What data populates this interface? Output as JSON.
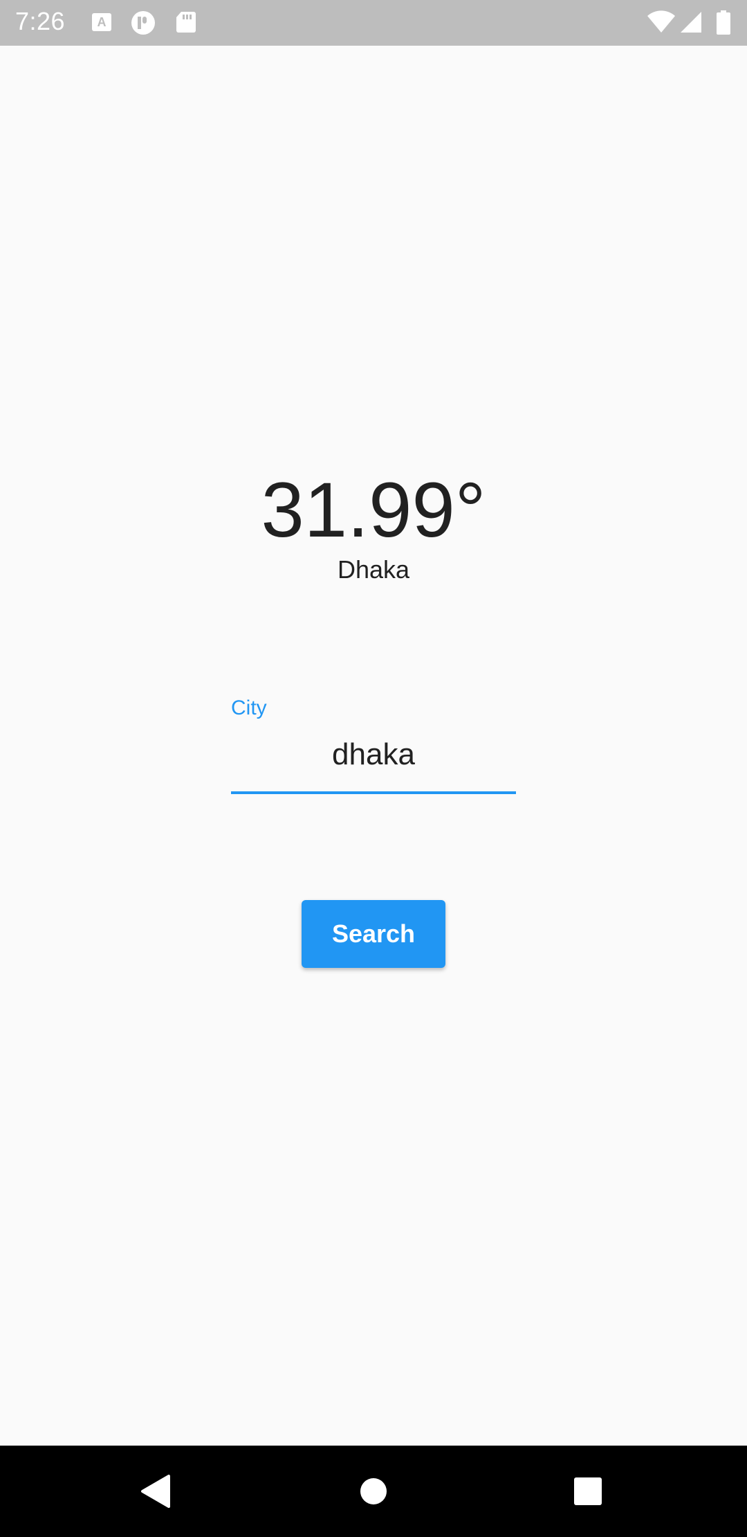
{
  "status_bar": {
    "time": "7:26",
    "left_icons": [
      "keyboard-a-icon",
      "circle-p-icon",
      "sd-card-icon"
    ],
    "right_icons": [
      "wifi-icon",
      "signal-icon",
      "battery-icon"
    ],
    "background": "#bdbdbd"
  },
  "weather": {
    "temperature": "31.99°",
    "city": "Dhaka"
  },
  "city_field": {
    "label": "City",
    "value": "dhaka",
    "accent_color": "#2196f3"
  },
  "search_button": {
    "label": "Search",
    "color": "#2196f3"
  },
  "nav_bar": {
    "buttons": [
      "back-icon",
      "home-icon",
      "recents-icon"
    ]
  }
}
